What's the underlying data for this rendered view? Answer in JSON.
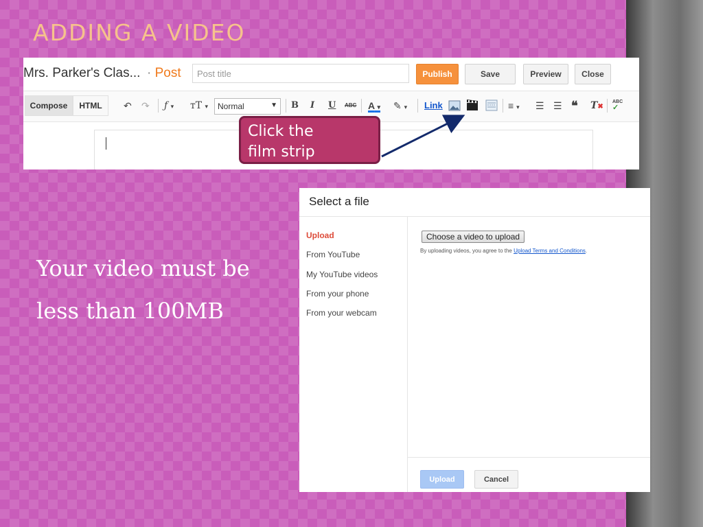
{
  "slide": {
    "title": "ADDING A VIDEO",
    "body_line1": "Your video must be",
    "body_line2": "less than 100MB",
    "colors": {
      "background": "#c95dba",
      "title": "#f6c28c",
      "callout": "#b8376a"
    }
  },
  "editor": {
    "blog_name": "Mrs. Parker's Clas...",
    "separator": "·",
    "post_label": "Post",
    "title_placeholder": "Post title",
    "buttons": {
      "publish": "Publish",
      "save": "Save",
      "preview": "Preview",
      "close": "Close"
    },
    "tabs": {
      "compose": "Compose",
      "html": "HTML"
    },
    "toolbar": {
      "font_glyph": "ƒ",
      "size_glyph": "тT",
      "format_value": "Normal",
      "bold": "B",
      "italic": "I",
      "underline": "U",
      "strike": "ABC",
      "text_color": "A",
      "link": "Link",
      "spellcheck": "ABC",
      "icons": [
        "undo-icon",
        "redo-icon",
        "font-icon",
        "font-size-icon",
        "text-color-icon",
        "highlight-icon",
        "image-icon",
        "video-icon",
        "jump-break-icon",
        "align-icon",
        "numbered-list-icon",
        "bullet-list-icon",
        "quote-icon",
        "clear-formatting-icon",
        "spellcheck-icon"
      ]
    }
  },
  "callout": {
    "line1": "Click the",
    "line2": "film strip"
  },
  "dialog": {
    "title": "Select a file",
    "nav": [
      "Upload",
      "From YouTube",
      "My YouTube videos",
      "From your phone",
      "From your webcam"
    ],
    "choose_button": "Choose a video to upload",
    "terms_prefix": "By uploading videos, you agree to the",
    "terms_link": "Upload Terms and Conditions",
    "terms_suffix": ".",
    "upload_button": "Upload",
    "cancel_button": "Cancel"
  }
}
